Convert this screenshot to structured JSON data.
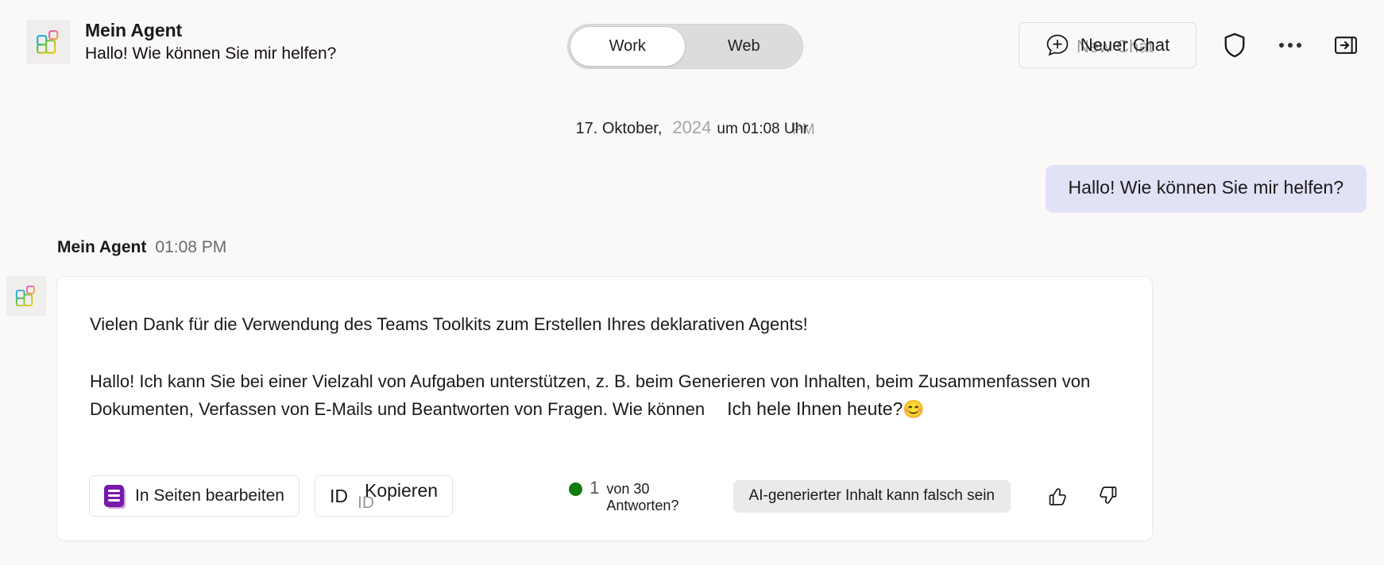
{
  "header": {
    "agent_name": "Mein Agent",
    "agent_subtitle": "Hallo!  Wie können Sie mir helfen?",
    "app_icon": "teams-toolkit-grid-icon",
    "scope_toggle": {
      "options": [
        "Work",
        "Web"
      ],
      "selected": "Work"
    },
    "new_chat_label": "Neuer Chat",
    "new_chat_ghost_label": "New Chat",
    "new_chat_icon": "add-chat-bubble-icon",
    "shield_icon": "shield-icon",
    "more_icon": "more-options-icon",
    "collapse_icon": "collapse-panel-icon"
  },
  "day_divider": {
    "date": "17. Oktober,",
    "year": "2024",
    "time": "um 01:08 Uhr",
    "time_ghost": "PM"
  },
  "user_message": {
    "text": "Hallo!   Wie können Sie mir helfen?",
    "bubble_color": "#e1e2f6"
  },
  "agent_message": {
    "byline_name": "Mein Agent",
    "byline_time": "01:08 PM",
    "avatar_icon": "teams-toolkit-grid-icon",
    "paragraph_thanks": "Vielen Dank für die Verwendung des Teams Toolkits zum Erstellen Ihres deklarativen Agents!",
    "paragraph_main": "Hallo!   Ich kann Sie bei einer Vielzahl von Aufgaben unterstützen, z. B. beim Generieren von Inhalten, beim Zusammenfassen von Dokumenten, Verfassen von E-Mails und Beantworten von Fragen. Wie können",
    "paragraph_tail": "Ich hele Ihnen heute?",
    "paragraph_emoji": "😊",
    "actions": {
      "edit_in_pages_label": "In Seiten bearbeiten",
      "edit_in_pages_icon": "loop-pages-icon",
      "copy_id_prefix": "ID",
      "copy_id_label": "Kopieren",
      "copy_id_ghost": "ID",
      "answers_count_number": "1",
      "answers_count_text": "von 30 Antworten?",
      "answers_status_color": "#107c10",
      "ai_disclaimer": "AI-generierter Inhalt kann falsch sein",
      "thumbs_up_icon": "thumbs-up-icon",
      "thumbs_down_icon": "thumbs-down-icon"
    }
  }
}
